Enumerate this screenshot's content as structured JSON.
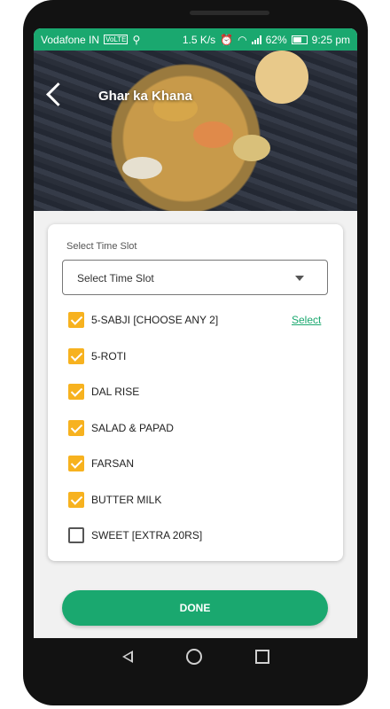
{
  "status_bar": {
    "carrier": "Vodafone IN",
    "network_badge": "VoLTE",
    "speed": "1.5 K/s",
    "battery": "62%",
    "time": "9:25 pm"
  },
  "header": {
    "title": "Ghar ka Khana"
  },
  "time_slot": {
    "label": "Select Time Slot",
    "value": "Select Time Slot"
  },
  "items": [
    {
      "label": "5-SABJI [CHOOSE ANY 2]",
      "checked": true,
      "action": "Select"
    },
    {
      "label": "5-ROTI",
      "checked": true
    },
    {
      "label": "DAL RISE",
      "checked": true
    },
    {
      "label": "SALAD & PAPAD",
      "checked": true
    },
    {
      "label": "FARSAN",
      "checked": true
    },
    {
      "label": "BUTTER MILK",
      "checked": true
    },
    {
      "label": "SWEET [EXTRA 20RS]",
      "checked": false
    }
  ],
  "done_button": {
    "label": "DONE"
  },
  "colors": {
    "accent": "#1aa86f",
    "checkbox": "#f7b21f"
  }
}
